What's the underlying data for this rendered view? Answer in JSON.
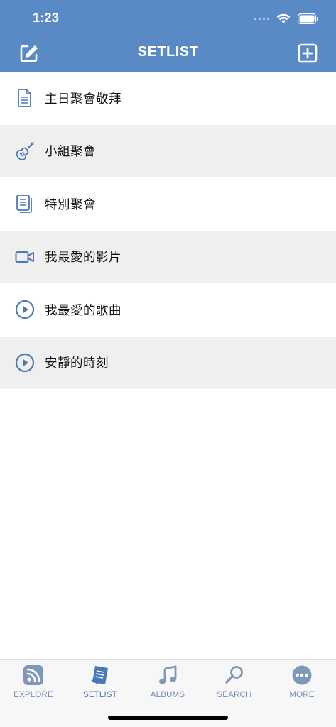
{
  "status_bar": {
    "time": "1:23"
  },
  "header": {
    "title": "SETLIST",
    "edit_icon": "edit-icon",
    "add_icon": "plus-square-icon"
  },
  "setlists": [
    {
      "label": "主日聚會敬拜",
      "icon": "document-icon"
    },
    {
      "label": "小組聚會",
      "icon": "guitar-icon"
    },
    {
      "label": "特別聚會",
      "icon": "documents-stack-icon"
    },
    {
      "label": "我最愛的影片",
      "icon": "video-camera-icon"
    },
    {
      "label": "我最愛的歌曲",
      "icon": "play-circle-icon"
    },
    {
      "label": "安靜的時刻",
      "icon": "play-circle-icon"
    }
  ],
  "tabs": [
    {
      "label": "EXPLORE",
      "icon": "rss-icon",
      "active": false
    },
    {
      "label": "SETLIST",
      "icon": "setlist-icon",
      "active": true
    },
    {
      "label": "ALBUMS",
      "icon": "music-note-icon",
      "active": false
    },
    {
      "label": "SEARCH",
      "icon": "search-icon",
      "active": false
    },
    {
      "label": "MORE",
      "icon": "more-icon",
      "active": false
    }
  ],
  "colors": {
    "header_bg": "#5a8ac6",
    "accent": "#4a79b5",
    "tab_inactive": "#6f8fb8",
    "row_alt_bg": "#efefef"
  }
}
